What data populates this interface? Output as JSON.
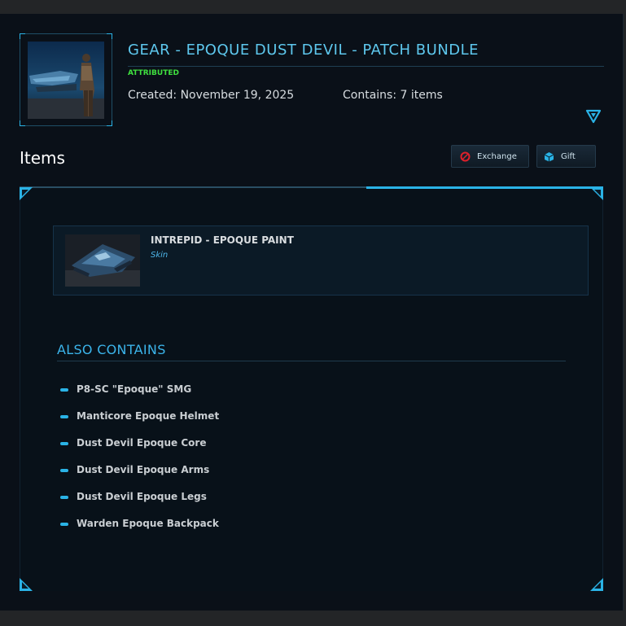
{
  "header": {
    "title": "GEAR - EPOQUE DUST DEVIL - PATCH BUNDLE",
    "status": "ATTRIBUTED",
    "created": "Created: November 19, 2025",
    "contains": "Contains: 7 items"
  },
  "items_section": {
    "heading": "Items",
    "exchange_label": "Exchange",
    "gift_label": "Gift"
  },
  "featured_item": {
    "name": "INTREPID - EPOQUE PAINT",
    "type": "Skin"
  },
  "also_contains": {
    "heading": "ALSO CONTAINS",
    "items": [
      "P8-SC \"Epoque\" SMG",
      "Manticore Epoque Helmet",
      "Dust Devil Epoque Core",
      "Dust Devil Epoque Arms",
      "Dust Devil Epoque Legs",
      "Warden Epoque Backpack"
    ]
  },
  "colors": {
    "accent": "#2ab3e6",
    "title": "#5ec8ee",
    "status": "#3fe03f",
    "background": "#0a1018"
  },
  "icons": {
    "exchange": "exchange-icon",
    "gift": "gift-icon",
    "expand": "triangle-down-icon"
  }
}
